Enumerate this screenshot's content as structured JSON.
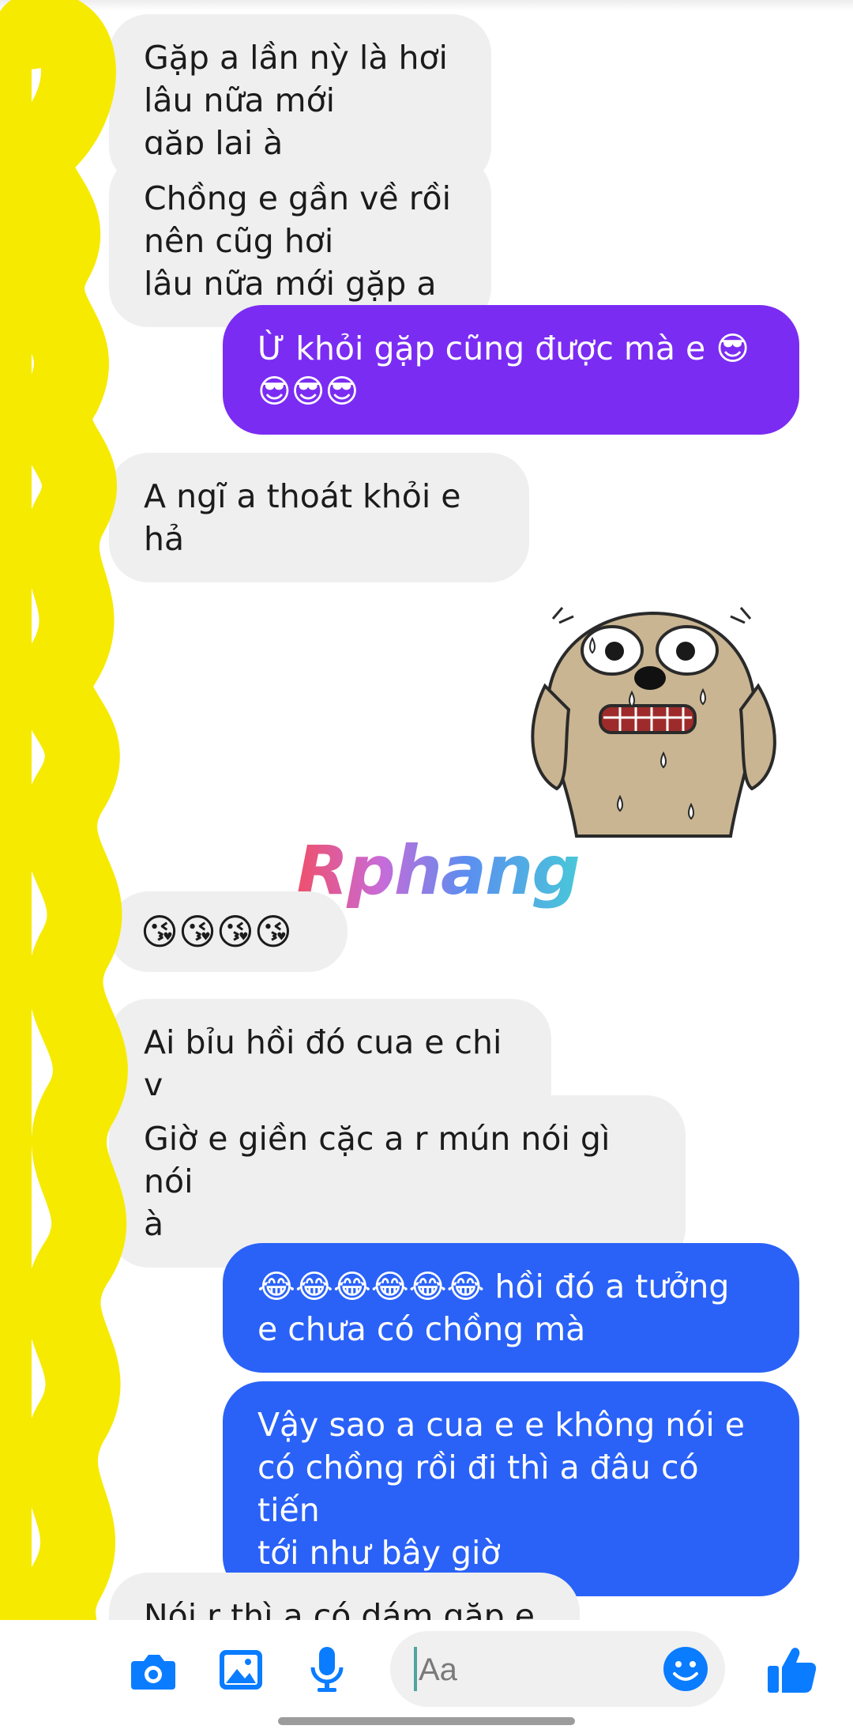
{
  "messages": [
    {
      "side": "in",
      "text": "Gặp a lần nỳ là hơi lâu nữa mới\ngặp lại à"
    },
    {
      "side": "in",
      "text": "Chồng e gần về rồi nên cũg hơi\nlâu nữa mới gặp a"
    },
    {
      "side": "out",
      "color": "#7b2cf3",
      "text": "Ừ khỏi gặp cũng được mà e 😎\n😎😎😎"
    },
    {
      "side": "in",
      "text": "A ngĩ a thoát khỏi e hả"
    },
    {
      "side": "in",
      "text": "😘😘😘😘"
    },
    {
      "side": "in",
      "text": "Ai bỉu hồi đó cua e chi v"
    },
    {
      "side": "in",
      "text": "Giờ e giền cặc a r mún nói gì nói\nà"
    },
    {
      "side": "out",
      "color": "#2a62f8",
      "text": "😂😂😂😂😂😂 hồi đó a tưởng\ne chưa có chồng mà"
    },
    {
      "side": "out",
      "color": "#2a62f8",
      "text": "Vậy sao a cua e e không nói e\ncó chồng rồi đi thì a đâu có tiến\ntới như bây giờ"
    },
    {
      "side": "in",
      "text": "Nói r thì a có dám gặp e k"
    }
  ],
  "sticker": {
    "name": "sweating-dog-sticker"
  },
  "watermark": {
    "text": "Rphang"
  },
  "composer": {
    "placeholder": "Aa",
    "icons": [
      "camera-icon",
      "image-icon",
      "microphone-icon",
      "emoji-icon",
      "thumbs-up-icon"
    ],
    "accent": "#0a7cff"
  }
}
